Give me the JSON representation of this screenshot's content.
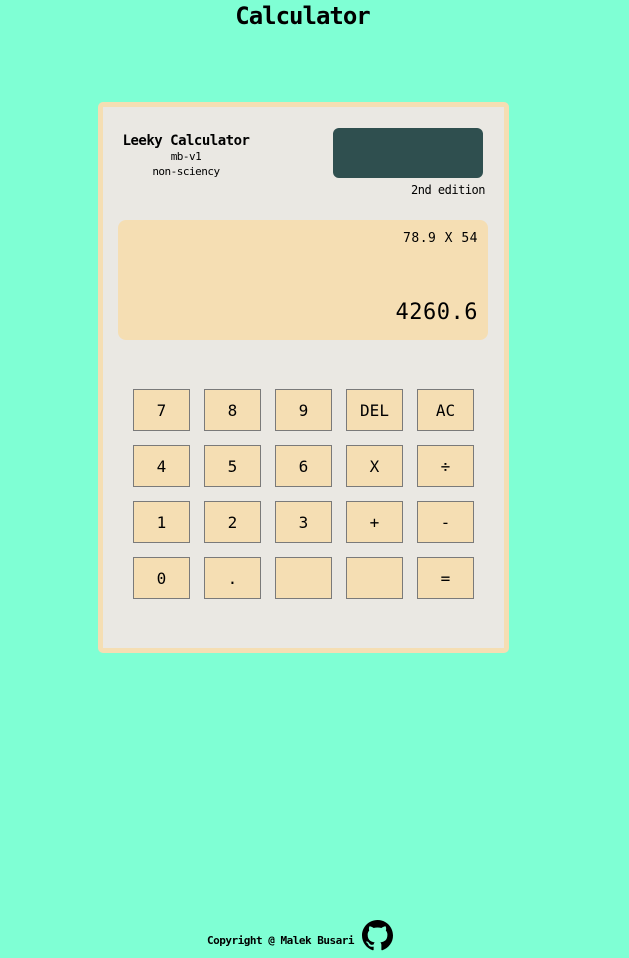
{
  "page": {
    "title": "Calculator"
  },
  "calculator": {
    "brand_name": "Leeky Calculator",
    "model": "mb-v1",
    "subtitle": "non-sciency",
    "edition": "2nd edition",
    "screen": {
      "expression": "78.9 X 54",
      "result": "4260.6"
    },
    "keys": [
      [
        "7",
        "8",
        "9",
        "DEL",
        "AC"
      ],
      [
        "4",
        "5",
        "6",
        "X",
        "÷"
      ],
      [
        "1",
        "2",
        "3",
        "+",
        "-"
      ],
      [
        "0",
        ".",
        "",
        "",
        "="
      ]
    ]
  },
  "footer": {
    "copyright": "Copyright @ Malek Busari",
    "icon": "github-icon"
  },
  "colors": {
    "background": "#7fffd4",
    "calculator_body": "#eae8e3",
    "accent": "#f5deb3",
    "solar_panel": "#2f4f4f"
  }
}
